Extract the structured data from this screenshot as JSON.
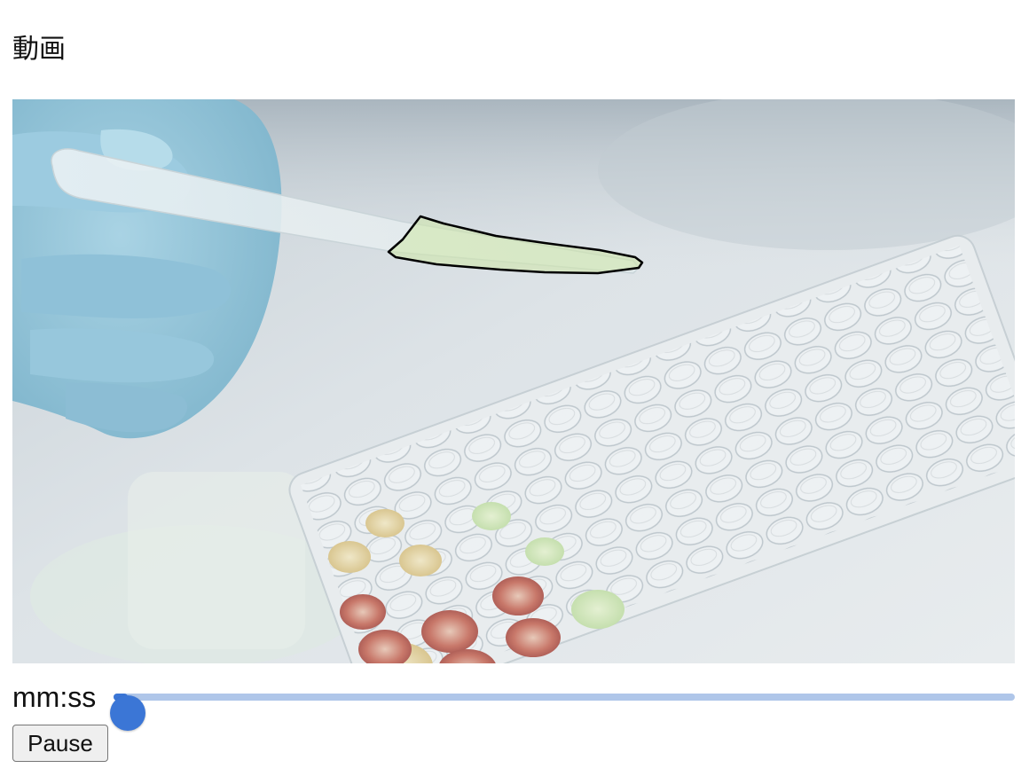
{
  "page": {
    "title": "動画"
  },
  "video": {
    "description_icon": "video-frame-image",
    "overlay_color": "#000000"
  },
  "player": {
    "time_label": "mm:ss",
    "position_fraction": 0.0,
    "seek_color": "#3b76d6",
    "seek_track_color": "#afc6e9",
    "pause_label": "Pause"
  }
}
